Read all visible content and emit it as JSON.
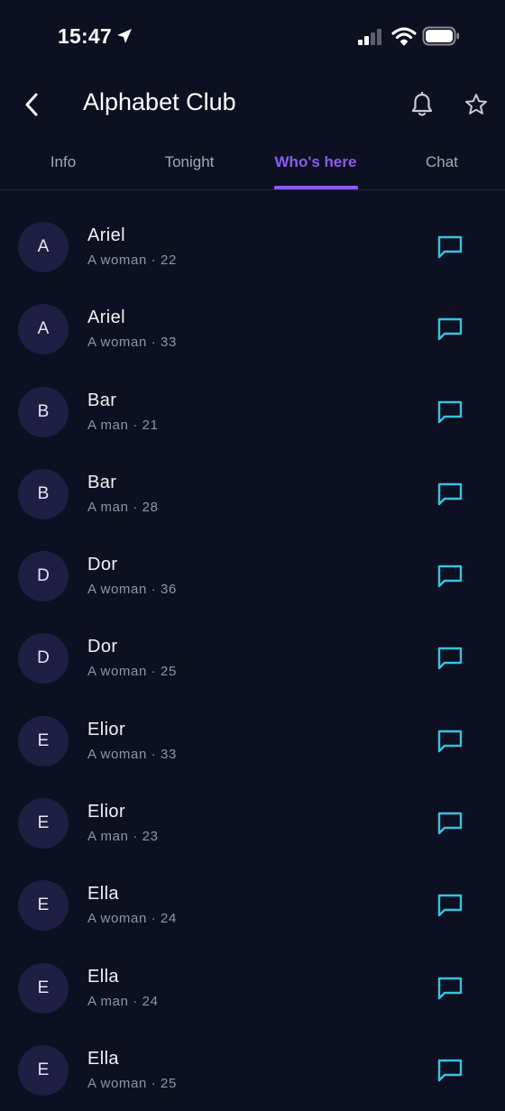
{
  "status_bar": {
    "time": "15:47"
  },
  "header": {
    "title": "Alphabet Club"
  },
  "tabs": [
    {
      "label": "Info"
    },
    {
      "label": "Tonight"
    },
    {
      "label": "Who's here",
      "active": true
    },
    {
      "label": "Chat"
    }
  ],
  "colors": {
    "background": "#0c1020",
    "accent": "#8c5cf0",
    "chat_icon": "#38c2e0",
    "avatar_bg": "#1f1f43"
  },
  "people": [
    {
      "initial": "A",
      "name": "Ariel",
      "meta": "A woman · 22"
    },
    {
      "initial": "A",
      "name": "Ariel",
      "meta": "A woman · 33"
    },
    {
      "initial": "B",
      "name": "Bar",
      "meta": "A man · 21"
    },
    {
      "initial": "B",
      "name": "Bar",
      "meta": "A man · 28"
    },
    {
      "initial": "D",
      "name": "Dor",
      "meta": "A woman · 36"
    },
    {
      "initial": "D",
      "name": "Dor",
      "meta": "A woman · 25"
    },
    {
      "initial": "E",
      "name": "Elior",
      "meta": "A woman · 33"
    },
    {
      "initial": "E",
      "name": "Elior",
      "meta": "A man · 23"
    },
    {
      "initial": "E",
      "name": "Ella",
      "meta": "A woman · 24"
    },
    {
      "initial": "E",
      "name": "Ella",
      "meta": "A man · 24"
    },
    {
      "initial": "E",
      "name": "Ella",
      "meta": "A woman · 25"
    }
  ]
}
